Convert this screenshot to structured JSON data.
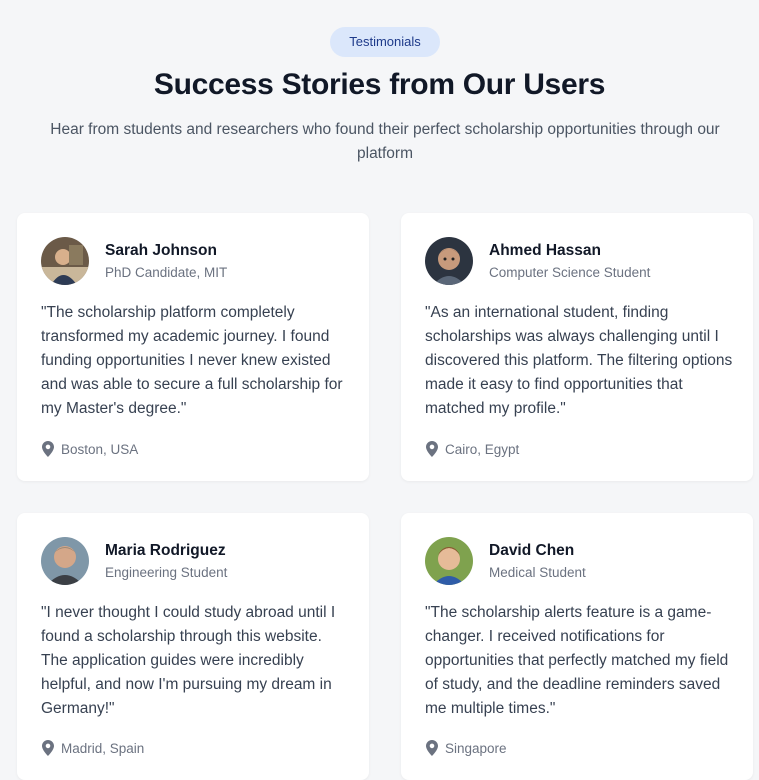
{
  "header": {
    "badge": "Testimonials",
    "title": "Success Stories from Our Users",
    "subtitle": "Hear from students and researchers who found their perfect scholarship opportunities through our platform"
  },
  "testimonials": [
    {
      "name": "Sarah Johnson",
      "role": "PhD Candidate, MIT",
      "quote": "\"The scholarship platform completely transformed my academic journey. I found funding opportunities I never knew existed and was able to secure a full scholarship for my Master's degree.\"",
      "location": "Boston, USA",
      "location_icon": "map-pin-icon"
    },
    {
      "name": "Ahmed Hassan",
      "role": "Computer Science Student",
      "quote": "\"As an international student, finding scholarships was always challenging until I discovered this platform. The filtering options made it easy to find opportunities that matched my profile.\"",
      "location": "Cairo, Egypt",
      "location_icon": "map-pin-icon"
    },
    {
      "name": "Maria Rodriguez",
      "role": "Engineering Student",
      "quote": "\"I never thought I could study abroad until I found a scholarship through this website. The application guides were incredibly helpful, and now I'm pursuing my dream in Germany!\"",
      "location": "Madrid, Spain",
      "location_icon": "map-pin-icon"
    },
    {
      "name": "David Chen",
      "role": "Medical Student",
      "quote": "\"The scholarship alerts feature is a game-changer. I received notifications for opportunities that perfectly matched my field of study, and the deadline reminders saved me multiple times.\"",
      "location": "Singapore",
      "location_icon": "map-pin-icon"
    }
  ],
  "colors": {
    "background": "#f5f6f8",
    "badge_bg": "#dbe7fb",
    "badge_text": "#1e3a8a",
    "card_bg": "#ffffff",
    "muted_text": "#6b7280"
  }
}
